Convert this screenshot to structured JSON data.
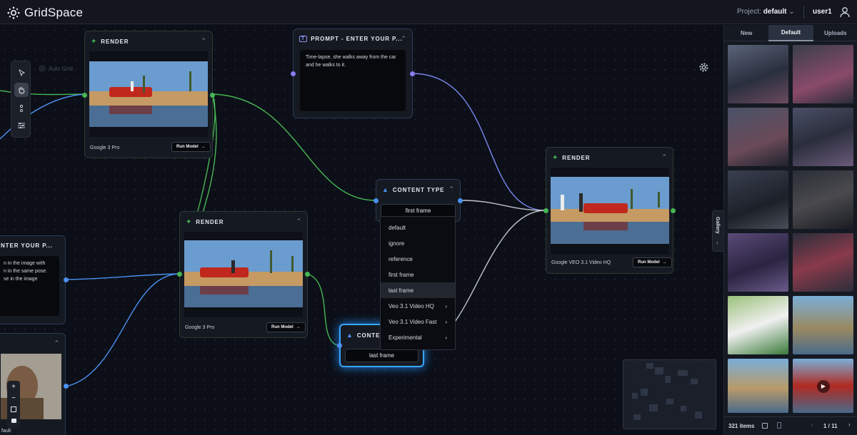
{
  "app": {
    "name": "GridSpace"
  },
  "header": {
    "project_label": "Project:",
    "project_value": "default",
    "user": "user1"
  },
  "canvas": {
    "auto_grid_label": "Auto Grid",
    "nodes": {
      "render1": {
        "title": "RENDER",
        "caption": "Google 3 Pro",
        "run_label": "Run Model"
      },
      "render2": {
        "title": "RENDER",
        "caption": "Google 3 Pro",
        "run_label": "Run Model"
      },
      "render3": {
        "title": "RENDER",
        "caption": "Google VEO 3.1 Video HQ",
        "run_label": "Run Model"
      },
      "prompt1": {
        "title": "PROMPT - ENTER YOUR P...",
        "text": "Time-lapse, she walks away from the car and he walks to it."
      },
      "prompt2": {
        "title": "NTER YOUR P...",
        "text_lines": [
          "n in the image with",
          "n in the same pose.",
          "se in the image"
        ]
      },
      "content_type1": {
        "title": "CONTENT TYPE",
        "value": "first frame"
      },
      "content_type2": {
        "title": "CONTENT",
        "value": "last frame"
      },
      "partial_node": {
        "caption": "fault"
      }
    },
    "dropdown": {
      "options": [
        {
          "label": "default",
          "arrow": ""
        },
        {
          "label": "ignore",
          "arrow": ""
        },
        {
          "label": "reference",
          "arrow": ""
        },
        {
          "label": "first frame",
          "arrow": ""
        },
        {
          "label": "last frame",
          "arrow": ""
        },
        {
          "label": "Veo 3.1 Video HQ",
          "arrow": "›"
        },
        {
          "label": "Veo 3.1 Video Fast",
          "arrow": "›"
        },
        {
          "label": "Experimental",
          "arrow": "›"
        }
      ],
      "highlighted_index": 4
    },
    "zoom": {
      "in": "+",
      "out": "−"
    }
  },
  "gallery": {
    "toggle_label": "Gallery",
    "tabs": [
      "New",
      "Default",
      "Uploads"
    ],
    "active_tab": "Default",
    "item_count": "321 items",
    "page": "1 / 11"
  },
  "colors": {
    "green_wire": "#46b554",
    "blue_wire": "#4a8ff0",
    "purple_wire": "#8a7cf0",
    "accent_glow": "#3aa4ff"
  }
}
